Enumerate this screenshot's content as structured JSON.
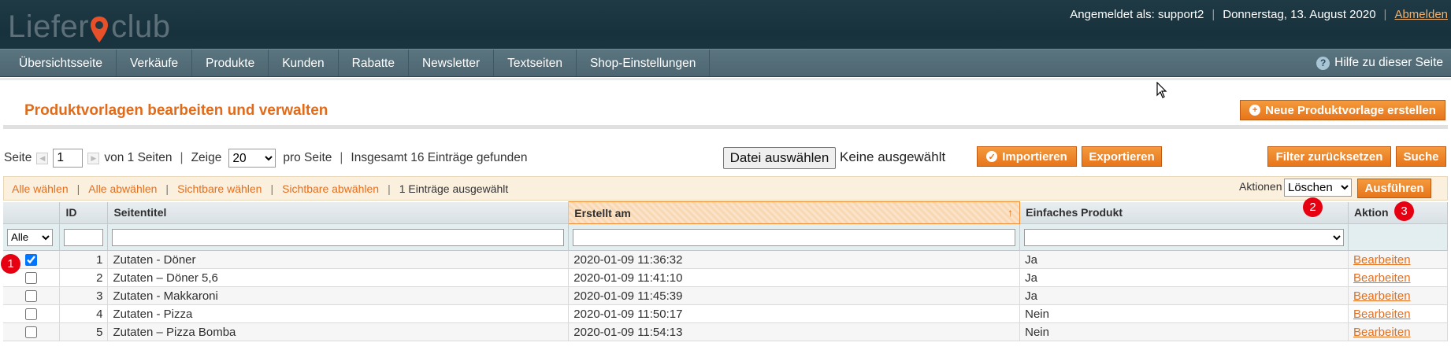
{
  "header": {
    "logo_left": "Liefer",
    "logo_right": "club",
    "logged_in": "Angemeldet als: support2",
    "date": "Donnerstag, 13. August 2020",
    "logout": "Abmelden",
    "accent_color": "#e7751b"
  },
  "nav": {
    "items": [
      {
        "label": "Übersichtsseite"
      },
      {
        "label": "Verkäufe"
      },
      {
        "label": "Produkte"
      },
      {
        "label": "Kunden"
      },
      {
        "label": "Rabatte"
      },
      {
        "label": "Newsletter"
      },
      {
        "label": "Textseiten"
      },
      {
        "label": "Shop-Einstellungen"
      }
    ],
    "help": "Hilfe zu dieser Seite"
  },
  "page": {
    "title": "Produktvorlagen bearbeiten und verwalten",
    "new_button": "Neue Produktvorlage erstellen"
  },
  "pager": {
    "seite": "Seite",
    "page": "1",
    "of_pages": "von 1 Seiten",
    "zeige": "Zeige",
    "per_page": "20",
    "pro_seite": "pro Seite",
    "total": "Insgesamt 16 Einträge gefunden"
  },
  "file": {
    "choose": "Datei auswählen",
    "none": "Keine ausgewählt"
  },
  "actions": {
    "import": "Importieren",
    "export": "Exportieren",
    "reset_filter": "Filter zurücksetzen",
    "search": "Suche"
  },
  "massaction": {
    "select_all": "Alle wählen",
    "unselect_all": "Alle abwählen",
    "select_visible": "Sichtbare wählen",
    "unselect_visible": "Sichtbare abwählen",
    "selected_count": "1 Einträge ausgewählt",
    "aktionen_label": "Aktionen",
    "aktion_value": "Löschen",
    "execute": "Ausführen"
  },
  "grid": {
    "headers": {
      "id": "ID",
      "title": "Seitentitel",
      "created": "Erstellt am",
      "simple": "Einfaches Produkt",
      "action": "Aktion"
    },
    "filter_all": "Alle",
    "rows": [
      {
        "checked": true,
        "id": "1",
        "title": "Zutaten - Döner",
        "created": "2020-01-09 11:36:32",
        "simple": "Ja",
        "action": "Bearbeiten"
      },
      {
        "checked": false,
        "id": "2",
        "title": "Zutaten – Döner 5,6",
        "created": "2020-01-09 11:41:10",
        "simple": "Ja",
        "action": "Bearbeiten"
      },
      {
        "checked": false,
        "id": "3",
        "title": "Zutaten - Makkaroni",
        "created": "2020-01-09 11:45:39",
        "simple": "Ja",
        "action": "Bearbeiten"
      },
      {
        "checked": false,
        "id": "4",
        "title": "Zutaten - Pizza",
        "created": "2020-01-09 11:50:17",
        "simple": "Nein",
        "action": "Bearbeiten"
      },
      {
        "checked": false,
        "id": "5",
        "title": "Zutaten – Pizza Bomba",
        "created": "2020-01-09 11:54:13",
        "simple": "Nein",
        "action": "Bearbeiten"
      }
    ]
  },
  "annotations": {
    "one": "1",
    "two": "2",
    "three": "3",
    "color": "#e60012"
  }
}
